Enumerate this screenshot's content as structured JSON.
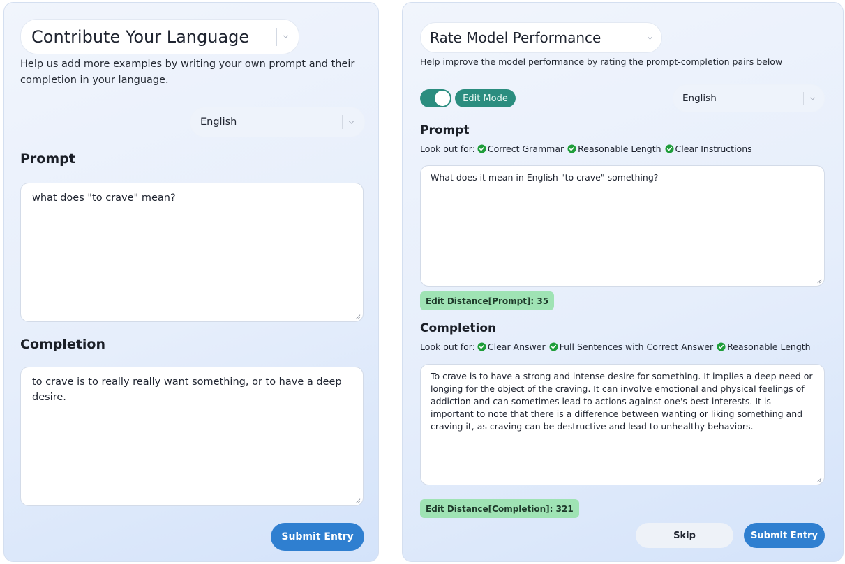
{
  "contribute": {
    "title": "Contribute Your Language",
    "help": "Help us add more examples by writing your own prompt and their completion in your language.",
    "language": "English",
    "prompt_heading": "Prompt",
    "prompt_text": "what does \"to crave\" mean?",
    "completion_heading": "Completion",
    "completion_text": "to crave is to really really want something, or to have a deep desire.",
    "submit_label": "Submit Entry"
  },
  "rate": {
    "title": "Rate Model Performance",
    "help": "Help improve the model performance by rating the prompt-completion pairs below",
    "edit_mode_label": "Edit Mode",
    "edit_mode_on": true,
    "language": "English",
    "prompt_heading": "Prompt",
    "lookout_prefix": "Look out for:",
    "prompt_criteria": [
      "Correct Grammar",
      "Reasonable Length",
      "Clear Instructions"
    ],
    "prompt_text": "What does it mean in English \"to crave\" something?",
    "prompt_edit_distance": "Edit Distance[Prompt]: 35",
    "completion_heading": "Completion",
    "completion_criteria": [
      "Clear Answer",
      "Full Sentences with Correct Answer",
      "Reasonable Length"
    ],
    "completion_text": "To crave is to have a strong and intense desire for something. It implies a deep need or longing for the object of the craving. It can involve emotional and physical feelings of addiction and can sometimes lead to actions against one's best interests. It is important to note that there is a difference between wanting or liking something and craving it, as craving can be destructive and lead to unhealthy behaviors.",
    "completion_edit_distance": "Edit Distance[Completion]: 321",
    "skip_label": "Skip",
    "submit_label": "Submit Entry"
  },
  "colors": {
    "primary_button": "#2f7fd0",
    "toggle_on": "#2b8d7f",
    "check_green": "#1f9d3a",
    "badge_green": "#9fe3b4"
  },
  "icons": {
    "dropdown": "chevron-down-icon",
    "criteria": "check-circle-icon",
    "resize": "resize-grip-icon"
  }
}
